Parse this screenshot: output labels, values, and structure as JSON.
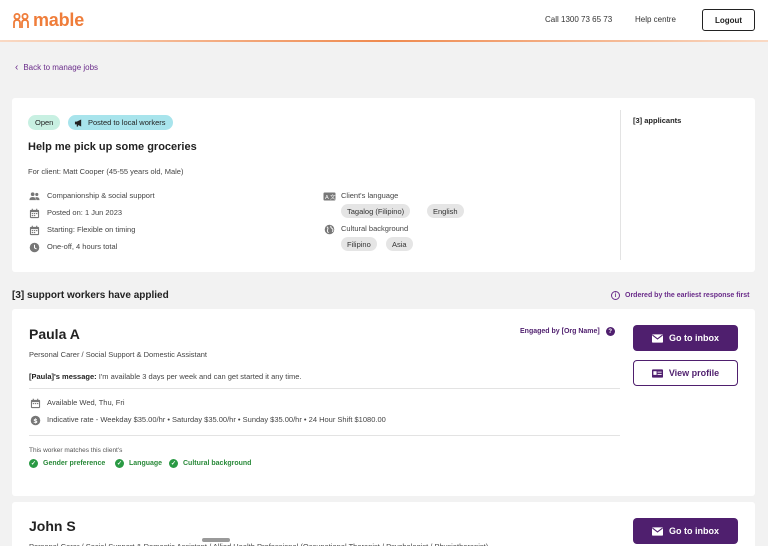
{
  "header": {
    "logo_text": "mable",
    "call_text": "Call 1300 73 65 73",
    "help_text": "Help centre",
    "logout_label": "Logout"
  },
  "nav": {
    "back_label": "Back to manage jobs"
  },
  "job": {
    "status_badge": "Open",
    "posted_badge": "Posted to local workers",
    "title": "Help me pick up some groceries",
    "client": "For client: Matt Cooper (45-55 years old, Male)",
    "service": "Companionship & social support",
    "posted_on": "Posted on: 1 Jun 2023",
    "starting": "Starting: Flexible on timing",
    "frequency": "One-off, 4 hours total",
    "language_label": "Client's language",
    "languages": [
      "Tagalog (Filipino)",
      "English"
    ],
    "culture_label": "Cultural background",
    "cultures": [
      "Filipino",
      "Asia"
    ],
    "applicants": "[3] applicants"
  },
  "applied": {
    "title": "[3] support workers have applied",
    "order_note": "Ordered by the earliest response first"
  },
  "workers": [
    {
      "name": "Paula A",
      "role": "Personal Carer / Social Support & Domestic Assistant",
      "message_prefix": "[Paula]'s message:",
      "message": " I'm available 3 days per week and can get started it any time.",
      "availability": "Available Wed, Thu, Fri",
      "rate": "Indicative rate - Weekday $35.00/hr • Saturday $35.00/hr • Sunday $35.00/hr • 24 Hour Shift $1080.00",
      "match_intro": "This worker matches this client's",
      "matches": [
        "Gender preference",
        "Language",
        "Cultural background"
      ],
      "engaged": "Engaged by [Org Name]",
      "inbox_label": "Go to inbox",
      "profile_label": "View profile"
    },
    {
      "name": "John S",
      "role": "Personal Carer / Social Support & Domestic Assistant / Allied Health Professional (Occupational Therapist / Psychologist / Physiotherapist)",
      "inbox_label": "Go to inbox"
    }
  ],
  "colors": {
    "brand": "#ef7d3a",
    "primary": "#4f1f6e",
    "open_badge": "#c8f0e2",
    "posted_badge": "#a8e4ec",
    "match_green": "#2a9a44"
  },
  "icons": [
    "mable-logo",
    "chevron-left-icon",
    "megaphone-icon",
    "people-icon",
    "calendar-icon",
    "clock-icon",
    "language-icon",
    "globe-icon",
    "info-icon",
    "question-icon",
    "mail-icon",
    "profile-card-icon",
    "dollar-icon",
    "check-icon"
  ]
}
